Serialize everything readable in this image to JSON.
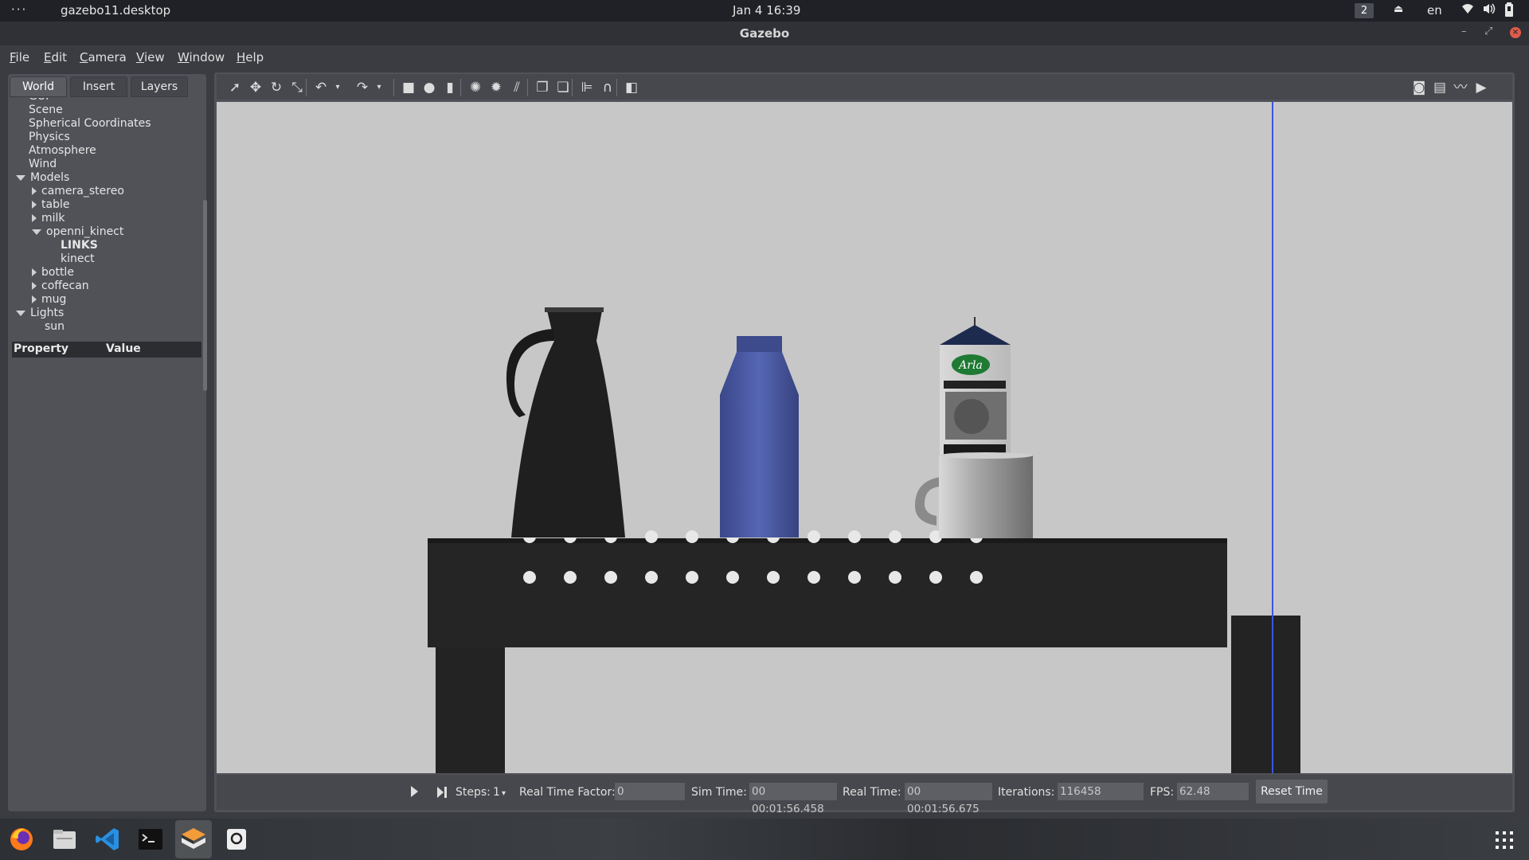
{
  "system_bar": {
    "menu_dots": "···",
    "app_name": "gazebo11.desktop",
    "clock": "Jan 4  16:39",
    "workspace": "2",
    "language": "en"
  },
  "window": {
    "title": "Gazebo",
    "close_glyph": "×",
    "minimize_glyph": "–",
    "maximize_glyph": "⤢"
  },
  "menu": {
    "items": [
      "File",
      "Edit",
      "Camera",
      "View",
      "Window",
      "Help"
    ]
  },
  "left_panel": {
    "tabs": [
      "World",
      "Insert",
      "Layers"
    ],
    "active_tab": "World",
    "tree": [
      {
        "label": "GUI",
        "indent": 0,
        "partial": true
      },
      {
        "label": "Scene",
        "indent": 0
      },
      {
        "label": "Spherical Coordinates",
        "indent": 0
      },
      {
        "label": "Physics",
        "indent": 0
      },
      {
        "label": "Atmosphere",
        "indent": 0
      },
      {
        "label": "Wind",
        "indent": 0
      },
      {
        "label": "Models",
        "indent": 0,
        "arrow": "down"
      },
      {
        "label": "camera_stereo",
        "indent": 1,
        "arrow": "right"
      },
      {
        "label": "table",
        "indent": 1,
        "arrow": "right"
      },
      {
        "label": "milk",
        "indent": 1,
        "arrow": "right"
      },
      {
        "label": "openni_kinect",
        "indent": 1,
        "arrow": "down"
      },
      {
        "label": "LINKS",
        "indent": 2,
        "bold": true
      },
      {
        "label": "kinect",
        "indent": 2
      },
      {
        "label": "bottle",
        "indent": 1,
        "arrow": "right"
      },
      {
        "label": "coffecan",
        "indent": 1,
        "arrow": "right"
      },
      {
        "label": "mug",
        "indent": 1,
        "arrow": "right"
      },
      {
        "label": "Lights",
        "indent": 0,
        "arrow": "down"
      },
      {
        "label": "sun",
        "indent": 1
      }
    ],
    "property_header": "Property",
    "value_header": "Value"
  },
  "toolbar": {
    "tools": [
      {
        "name": "select-icon",
        "glyph": "➚"
      },
      {
        "name": "translate-icon",
        "glyph": "✥"
      },
      {
        "name": "rotate-icon",
        "glyph": "↻"
      },
      {
        "name": "scale-icon",
        "glyph": "⤡"
      },
      {
        "name": "undo-icon",
        "glyph": "↶"
      },
      {
        "name": "undo-dropdown-icon",
        "glyph": "▾"
      },
      {
        "name": "redo-icon",
        "glyph": "↷"
      },
      {
        "name": "redo-dropdown-icon",
        "glyph": "▾"
      },
      {
        "name": "box-shape-icon",
        "glyph": "■"
      },
      {
        "name": "sphere-shape-icon",
        "glyph": "●"
      },
      {
        "name": "cylinder-shape-icon",
        "glyph": "▮"
      },
      {
        "name": "point-light-icon",
        "glyph": "✺"
      },
      {
        "name": "spot-light-icon",
        "glyph": "✹"
      },
      {
        "name": "directional-light-icon",
        "glyph": "⫽"
      },
      {
        "name": "copy-icon",
        "glyph": "❐"
      },
      {
        "name": "paste-icon",
        "glyph": "❏"
      },
      {
        "name": "align-icon",
        "glyph": "⊫"
      },
      {
        "name": "snap-icon",
        "glyph": "∩"
      },
      {
        "name": "view-angle-icon",
        "glyph": "◧"
      }
    ],
    "right_tools": [
      {
        "name": "screenshot-icon",
        "glyph": "◙"
      },
      {
        "name": "log-icon",
        "glyph": "▤"
      },
      {
        "name": "plot-icon",
        "glyph": "〰"
      },
      {
        "name": "record-video-icon",
        "glyph": "▶"
      }
    ]
  },
  "scene": {
    "carton_brand": "Arla"
  },
  "status": {
    "steps_label": "Steps:",
    "steps_value": "1",
    "rtf_label": "Real Time Factor:",
    "rtf_value": "0",
    "sim_time_label": "Sim Time:",
    "sim_time_value": "00 00:01:56.458",
    "real_time_label": "Real Time:",
    "real_time_value": "00 00:01:56.675",
    "iterations_label": "Iterations:",
    "iterations_value": "116458",
    "fps_label": "FPS:",
    "fps_value": "62.48",
    "reset_label": "Reset Time"
  },
  "colors": {
    "bottle_blue": "#4b5aa6",
    "viewport_bg": "#c7c7c7",
    "close_red": "#e05a4a"
  }
}
